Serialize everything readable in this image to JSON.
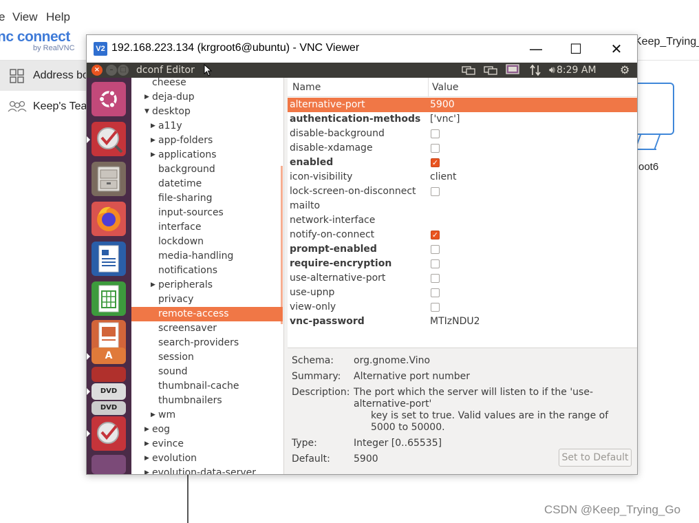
{
  "bg_app": {
    "menu": [
      "e",
      "View",
      "Help"
    ],
    "logo_text": "nc connect",
    "logo_sub": "by RealVNC",
    "sidebar": {
      "address_book": "Address bo",
      "team": "Keep's Tea"
    },
    "team_chip": "Keep_Trying_",
    "computer_name": "oot6"
  },
  "watermark": "CSDN @Keep_Trying_Go",
  "vnc": {
    "title": "192.168.223.134 (krgroot6@ubuntu) - VNC Viewer",
    "icon_text": "V2",
    "minimize": "—",
    "maximize": "☐",
    "close": "✕"
  },
  "ubuntu": {
    "app_title": "dconf Editor",
    "time": "8:29 AM",
    "tray_icons": [
      "network-icon",
      "network-icon",
      "display-icon",
      "transfer-icon",
      "volume-icon",
      "settings-icon"
    ]
  },
  "tree": {
    "rows": [
      {
        "label": "cheese",
        "level": 1,
        "arrow": ""
      },
      {
        "label": "deja-dup",
        "level": 1,
        "arrow": "right"
      },
      {
        "label": "desktop",
        "level": 1,
        "arrow": "down"
      },
      {
        "label": "a11y",
        "level": 2,
        "arrow": "right"
      },
      {
        "label": "app-folders",
        "level": 2,
        "arrow": "right"
      },
      {
        "label": "applications",
        "level": 2,
        "arrow": "right"
      },
      {
        "label": "background",
        "level": 2,
        "arrow": ""
      },
      {
        "label": "datetime",
        "level": 2,
        "arrow": ""
      },
      {
        "label": "file-sharing",
        "level": 2,
        "arrow": ""
      },
      {
        "label": "input-sources",
        "level": 2,
        "arrow": ""
      },
      {
        "label": "interface",
        "level": 2,
        "arrow": ""
      },
      {
        "label": "lockdown",
        "level": 2,
        "arrow": ""
      },
      {
        "label": "media-handling",
        "level": 2,
        "arrow": ""
      },
      {
        "label": "notifications",
        "level": 2,
        "arrow": ""
      },
      {
        "label": "peripherals",
        "level": 2,
        "arrow": "right"
      },
      {
        "label": "privacy",
        "level": 2,
        "arrow": ""
      },
      {
        "label": "remote-access",
        "level": 2,
        "arrow": "",
        "selected": true
      },
      {
        "label": "screensaver",
        "level": 2,
        "arrow": ""
      },
      {
        "label": "search-providers",
        "level": 2,
        "arrow": ""
      },
      {
        "label": "session",
        "level": 2,
        "arrow": ""
      },
      {
        "label": "sound",
        "level": 2,
        "arrow": ""
      },
      {
        "label": "thumbnail-cache",
        "level": 2,
        "arrow": ""
      },
      {
        "label": "thumbnailers",
        "level": 2,
        "arrow": ""
      },
      {
        "label": "wm",
        "level": 2,
        "arrow": "right"
      },
      {
        "label": "eog",
        "level": 1,
        "arrow": "right"
      },
      {
        "label": "evince",
        "level": 1,
        "arrow": "right"
      },
      {
        "label": "evolution",
        "level": 1,
        "arrow": "right"
      },
      {
        "label": "evolution-data-server",
        "level": 1,
        "arrow": "right"
      }
    ]
  },
  "keys": {
    "header": {
      "name": "Name",
      "value": "Value"
    },
    "rows": [
      {
        "name": "alternative-port",
        "bold": false,
        "type": "text",
        "value": "5900",
        "selected": true
      },
      {
        "name": "authentication-methods",
        "bold": true,
        "type": "text",
        "value": "['vnc']"
      },
      {
        "name": "disable-background",
        "bold": false,
        "type": "check",
        "checked": false
      },
      {
        "name": "disable-xdamage",
        "bold": false,
        "type": "check",
        "checked": false
      },
      {
        "name": "enabled",
        "bold": true,
        "type": "check",
        "checked": true
      },
      {
        "name": "icon-visibility",
        "bold": false,
        "type": "text",
        "value": "client"
      },
      {
        "name": "lock-screen-on-disconnect",
        "bold": false,
        "type": "check",
        "checked": false
      },
      {
        "name": "mailto",
        "bold": false,
        "type": "text",
        "value": ""
      },
      {
        "name": "network-interface",
        "bold": false,
        "type": "text",
        "value": ""
      },
      {
        "name": "notify-on-connect",
        "bold": false,
        "type": "check",
        "checked": true
      },
      {
        "name": "prompt-enabled",
        "bold": true,
        "type": "check",
        "checked": false
      },
      {
        "name": "require-encryption",
        "bold": true,
        "type": "check",
        "checked": false
      },
      {
        "name": "use-alternative-port",
        "bold": false,
        "type": "check",
        "checked": false
      },
      {
        "name": "use-upnp",
        "bold": false,
        "type": "check",
        "checked": false
      },
      {
        "name": "view-only",
        "bold": false,
        "type": "check",
        "checked": false
      },
      {
        "name": "vnc-password",
        "bold": true,
        "type": "text",
        "value": "MTIzNDU2"
      }
    ]
  },
  "details": {
    "schema_label": "Schema:",
    "schema": "org.gnome.Vino",
    "summary_label": "Summary:",
    "summary": "Alternative port number",
    "description_label": "Description:",
    "description_1": "The port which the server will listen to if the 'use-alternative-port'",
    "description_2": "key is set to true. Valid values are in the range of 5000 to 50000.",
    "type_label": "Type:",
    "type": "Integer [0..65535]",
    "default_label": "Default:",
    "default": "5900",
    "set_default_button": "Set to Default"
  },
  "colors": {
    "ubuntu_orange": "#e95420",
    "selection": "#f07746",
    "launcher": "#4a2b47",
    "panel": "#3c3b37"
  }
}
